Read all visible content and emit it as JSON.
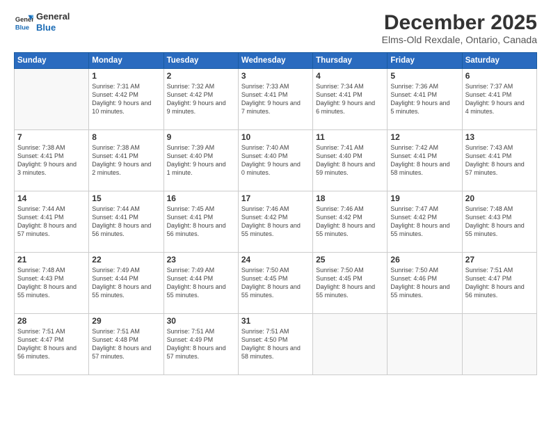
{
  "header": {
    "logo_general": "General",
    "logo_blue": "Blue",
    "title": "December 2025",
    "subtitle": "Elms-Old Rexdale, Ontario, Canada"
  },
  "days_of_week": [
    "Sunday",
    "Monday",
    "Tuesday",
    "Wednesday",
    "Thursday",
    "Friday",
    "Saturday"
  ],
  "weeks": [
    [
      {
        "day": "",
        "empty": true
      },
      {
        "day": "1",
        "sunrise": "Sunrise: 7:31 AM",
        "sunset": "Sunset: 4:42 PM",
        "daylight": "Daylight: 9 hours and 10 minutes."
      },
      {
        "day": "2",
        "sunrise": "Sunrise: 7:32 AM",
        "sunset": "Sunset: 4:42 PM",
        "daylight": "Daylight: 9 hours and 9 minutes."
      },
      {
        "day": "3",
        "sunrise": "Sunrise: 7:33 AM",
        "sunset": "Sunset: 4:41 PM",
        "daylight": "Daylight: 9 hours and 7 minutes."
      },
      {
        "day": "4",
        "sunrise": "Sunrise: 7:34 AM",
        "sunset": "Sunset: 4:41 PM",
        "daylight": "Daylight: 9 hours and 6 minutes."
      },
      {
        "day": "5",
        "sunrise": "Sunrise: 7:36 AM",
        "sunset": "Sunset: 4:41 PM",
        "daylight": "Daylight: 9 hours and 5 minutes."
      },
      {
        "day": "6",
        "sunrise": "Sunrise: 7:37 AM",
        "sunset": "Sunset: 4:41 PM",
        "daylight": "Daylight: 9 hours and 4 minutes."
      }
    ],
    [
      {
        "day": "7",
        "sunrise": "Sunrise: 7:38 AM",
        "sunset": "Sunset: 4:41 PM",
        "daylight": "Daylight: 9 hours and 3 minutes."
      },
      {
        "day": "8",
        "sunrise": "Sunrise: 7:38 AM",
        "sunset": "Sunset: 4:41 PM",
        "daylight": "Daylight: 9 hours and 2 minutes."
      },
      {
        "day": "9",
        "sunrise": "Sunrise: 7:39 AM",
        "sunset": "Sunset: 4:40 PM",
        "daylight": "Daylight: 9 hours and 1 minute."
      },
      {
        "day": "10",
        "sunrise": "Sunrise: 7:40 AM",
        "sunset": "Sunset: 4:40 PM",
        "daylight": "Daylight: 9 hours and 0 minutes."
      },
      {
        "day": "11",
        "sunrise": "Sunrise: 7:41 AM",
        "sunset": "Sunset: 4:40 PM",
        "daylight": "Daylight: 8 hours and 59 minutes."
      },
      {
        "day": "12",
        "sunrise": "Sunrise: 7:42 AM",
        "sunset": "Sunset: 4:41 PM",
        "daylight": "Daylight: 8 hours and 58 minutes."
      },
      {
        "day": "13",
        "sunrise": "Sunrise: 7:43 AM",
        "sunset": "Sunset: 4:41 PM",
        "daylight": "Daylight: 8 hours and 57 minutes."
      }
    ],
    [
      {
        "day": "14",
        "sunrise": "Sunrise: 7:44 AM",
        "sunset": "Sunset: 4:41 PM",
        "daylight": "Daylight: 8 hours and 57 minutes."
      },
      {
        "day": "15",
        "sunrise": "Sunrise: 7:44 AM",
        "sunset": "Sunset: 4:41 PM",
        "daylight": "Daylight: 8 hours and 56 minutes."
      },
      {
        "day": "16",
        "sunrise": "Sunrise: 7:45 AM",
        "sunset": "Sunset: 4:41 PM",
        "daylight": "Daylight: 8 hours and 56 minutes."
      },
      {
        "day": "17",
        "sunrise": "Sunrise: 7:46 AM",
        "sunset": "Sunset: 4:42 PM",
        "daylight": "Daylight: 8 hours and 55 minutes."
      },
      {
        "day": "18",
        "sunrise": "Sunrise: 7:46 AM",
        "sunset": "Sunset: 4:42 PM",
        "daylight": "Daylight: 8 hours and 55 minutes."
      },
      {
        "day": "19",
        "sunrise": "Sunrise: 7:47 AM",
        "sunset": "Sunset: 4:42 PM",
        "daylight": "Daylight: 8 hours and 55 minutes."
      },
      {
        "day": "20",
        "sunrise": "Sunrise: 7:48 AM",
        "sunset": "Sunset: 4:43 PM",
        "daylight": "Daylight: 8 hours and 55 minutes."
      }
    ],
    [
      {
        "day": "21",
        "sunrise": "Sunrise: 7:48 AM",
        "sunset": "Sunset: 4:43 PM",
        "daylight": "Daylight: 8 hours and 55 minutes."
      },
      {
        "day": "22",
        "sunrise": "Sunrise: 7:49 AM",
        "sunset": "Sunset: 4:44 PM",
        "daylight": "Daylight: 8 hours and 55 minutes."
      },
      {
        "day": "23",
        "sunrise": "Sunrise: 7:49 AM",
        "sunset": "Sunset: 4:44 PM",
        "daylight": "Daylight: 8 hours and 55 minutes."
      },
      {
        "day": "24",
        "sunrise": "Sunrise: 7:50 AM",
        "sunset": "Sunset: 4:45 PM",
        "daylight": "Daylight: 8 hours and 55 minutes."
      },
      {
        "day": "25",
        "sunrise": "Sunrise: 7:50 AM",
        "sunset": "Sunset: 4:45 PM",
        "daylight": "Daylight: 8 hours and 55 minutes."
      },
      {
        "day": "26",
        "sunrise": "Sunrise: 7:50 AM",
        "sunset": "Sunset: 4:46 PM",
        "daylight": "Daylight: 8 hours and 55 minutes."
      },
      {
        "day": "27",
        "sunrise": "Sunrise: 7:51 AM",
        "sunset": "Sunset: 4:47 PM",
        "daylight": "Daylight: 8 hours and 56 minutes."
      }
    ],
    [
      {
        "day": "28",
        "sunrise": "Sunrise: 7:51 AM",
        "sunset": "Sunset: 4:47 PM",
        "daylight": "Daylight: 8 hours and 56 minutes."
      },
      {
        "day": "29",
        "sunrise": "Sunrise: 7:51 AM",
        "sunset": "Sunset: 4:48 PM",
        "daylight": "Daylight: 8 hours and 57 minutes."
      },
      {
        "day": "30",
        "sunrise": "Sunrise: 7:51 AM",
        "sunset": "Sunset: 4:49 PM",
        "daylight": "Daylight: 8 hours and 57 minutes."
      },
      {
        "day": "31",
        "sunrise": "Sunrise: 7:51 AM",
        "sunset": "Sunset: 4:50 PM",
        "daylight": "Daylight: 8 hours and 58 minutes."
      },
      {
        "day": "",
        "empty": true
      },
      {
        "day": "",
        "empty": true
      },
      {
        "day": "",
        "empty": true
      }
    ]
  ]
}
